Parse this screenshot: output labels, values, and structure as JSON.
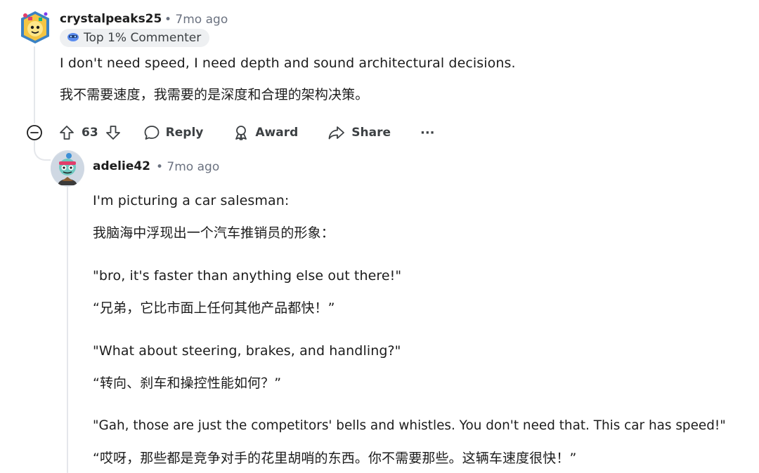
{
  "comment": {
    "username": "crystalpeaks25",
    "time": "• 7mo ago",
    "badge": "Top 1% Commenter",
    "lines": [
      "I don't need speed, I need depth and sound architectural decisions.",
      "我不需要速度，我需要的是深度和合理的架构决策。"
    ],
    "actions": {
      "votes": "63",
      "reply": "Reply",
      "award": "Award",
      "share": "Share",
      "more": "···"
    }
  },
  "reply": {
    "username": "adelie42",
    "time": "• 7mo ago",
    "lines": [
      "I'm picturing a car salesman:",
      "我脑海中浮现出一个汽车推销员的形象：",
      "\"bro, it's faster than anything else out there!\"",
      "“兄弟，它比市面上任何其他产品都快！”",
      "\"What about steering, brakes, and handling?\"",
      "“转向、刹车和操控性能如何？”",
      "\"Gah, those are just the competitors' bells and whistles. You don't need that. This car has speed!\"",
      "“哎呀，那些都是竞争对手的花里胡哨的东西。你不需要那些。这辆车速度很快！”"
    ]
  },
  "icons": {
    "collapse": "minus-circle-icon",
    "upvote": "arrow-up-icon",
    "downvote": "arrow-down-icon",
    "reply": "speech-bubble-icon",
    "award": "award-icon",
    "share": "share-arrow-icon",
    "badge": "commenter-badge-icon"
  },
  "colors": {
    "text": "#1c1c1c",
    "meta": "#6b7280",
    "thread_line": "#e5e7eb",
    "badge_bg": "#eef0f2"
  }
}
